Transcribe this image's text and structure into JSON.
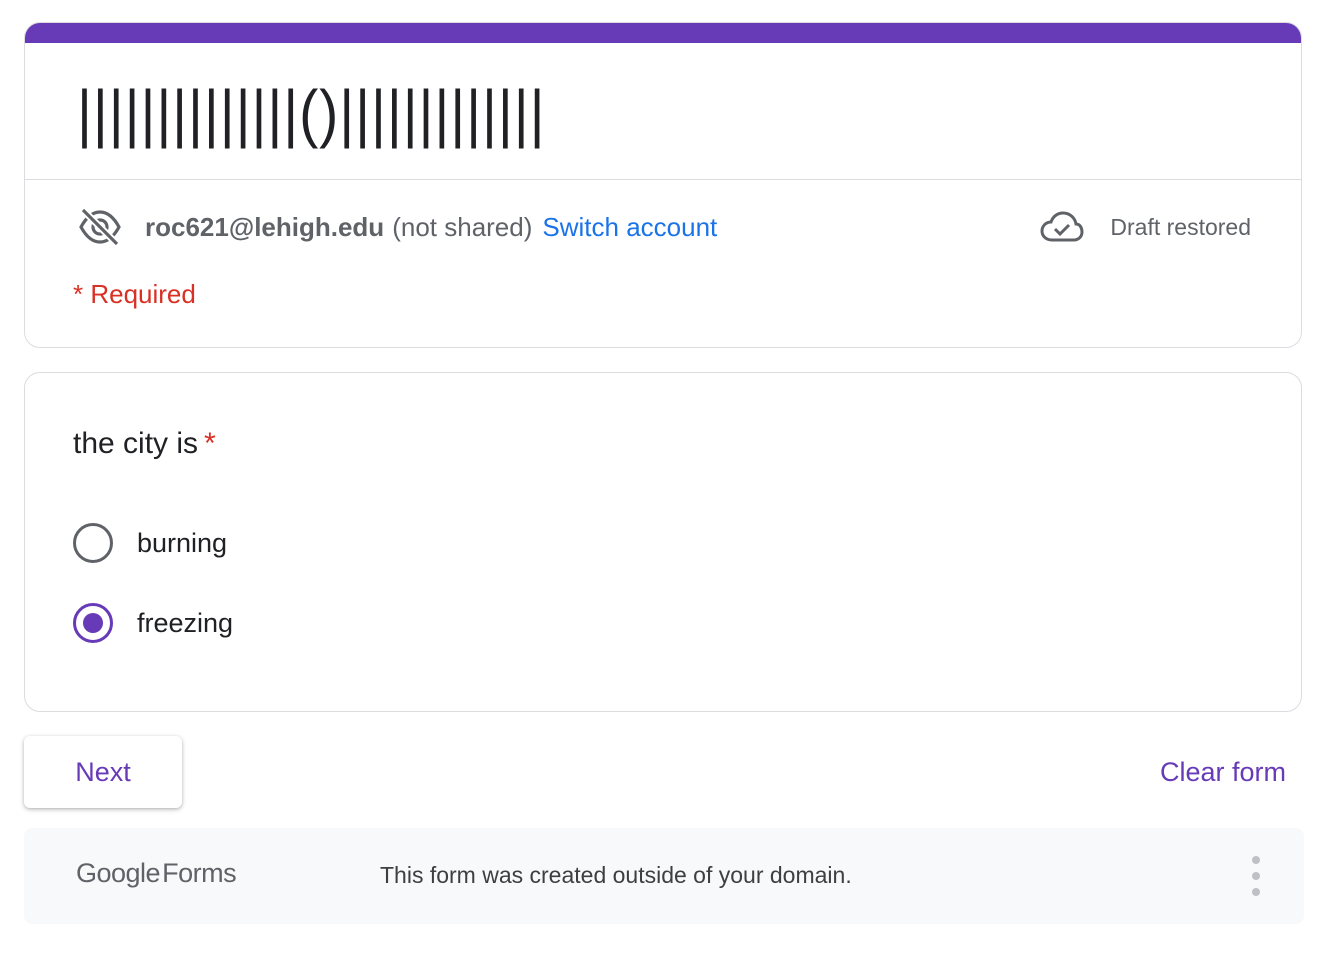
{
  "form": {
    "title": "||||||||||||||()|||||||||||||",
    "accent_color": "#673ab7"
  },
  "account": {
    "icon": "eye-off-icon",
    "email": "roc621@lehigh.edu",
    "note": "(not shared)",
    "switch_label": "Switch account",
    "draft_icon": "cloud-check-icon",
    "draft_status": "Draft restored"
  },
  "required_note": "* Required",
  "question": {
    "title": "the city is",
    "required_mark": "*",
    "options": [
      {
        "label": "burning",
        "selected": false
      },
      {
        "label": "freezing",
        "selected": true
      }
    ]
  },
  "actions": {
    "next_label": "Next",
    "clear_label": "Clear form"
  },
  "footer": {
    "logo_google": "Google",
    "logo_forms": "Forms",
    "notice": "This form was created outside of your domain.",
    "menu_icon": "more-vert-icon"
  }
}
